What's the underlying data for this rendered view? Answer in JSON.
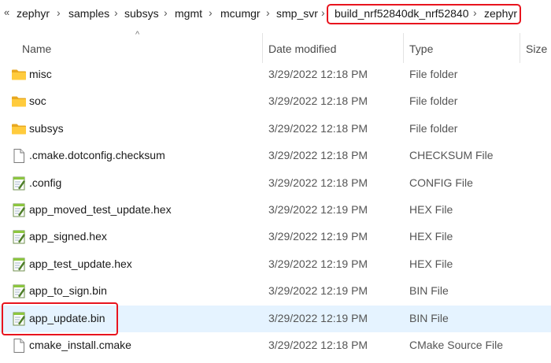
{
  "breadcrumb": {
    "overflow": "«",
    "items": [
      "zephyr",
      "samples",
      "subsys",
      "mgmt",
      "mcumgr",
      "smp_svr",
      "build_nrf52840dk_nrf52840",
      "zephyr"
    ]
  },
  "columns": {
    "name": "Name",
    "date": "Date modified",
    "type": "Type",
    "size": "Size"
  },
  "sort_indicator": "^",
  "files": [
    {
      "name": "misc",
      "date": "3/29/2022 12:18 PM",
      "type": "File folder",
      "icon": "folder-icon"
    },
    {
      "name": "soc",
      "date": "3/29/2022 12:18 PM",
      "type": "File folder",
      "icon": "folder-icon"
    },
    {
      "name": "subsys",
      "date": "3/29/2022 12:18 PM",
      "type": "File folder",
      "icon": "folder-icon"
    },
    {
      "name": ".cmake.dotconfig.checksum",
      "date": "3/29/2022 12:18 PM",
      "type": "CHECKSUM File",
      "icon": "blank-file-icon"
    },
    {
      "name": ".config",
      "date": "3/29/2022 12:18 PM",
      "type": "CONFIG File",
      "icon": "notepad-file-icon"
    },
    {
      "name": "app_moved_test_update.hex",
      "date": "3/29/2022 12:19 PM",
      "type": "HEX File",
      "icon": "notepad-file-icon"
    },
    {
      "name": "app_signed.hex",
      "date": "3/29/2022 12:19 PM",
      "type": "HEX File",
      "icon": "notepad-file-icon"
    },
    {
      "name": "app_test_update.hex",
      "date": "3/29/2022 12:19 PM",
      "type": "HEX File",
      "icon": "notepad-file-icon"
    },
    {
      "name": "app_to_sign.bin",
      "date": "3/29/2022 12:19 PM",
      "type": "BIN File",
      "icon": "notepad-file-icon"
    },
    {
      "name": "app_update.bin",
      "date": "3/29/2022 12:19 PM",
      "type": "BIN File",
      "icon": "notepad-file-icon",
      "selected": true
    },
    {
      "name": "cmake_install.cmake",
      "date": "3/29/2022 12:18 PM",
      "type": "CMake Source File",
      "icon": "blank-file-icon"
    }
  ]
}
